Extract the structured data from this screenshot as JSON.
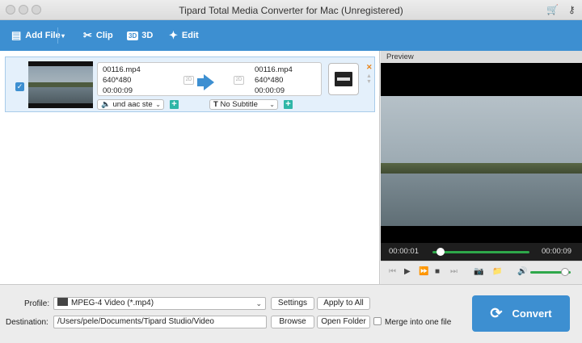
{
  "window": {
    "title": "Tipard Total Media Converter for Mac (Unregistered)"
  },
  "toolbar": {
    "add_file": "Add File",
    "clip": "Clip",
    "three_d": "3D",
    "three_d_badge": "3D",
    "edit": "Edit"
  },
  "file": {
    "source": {
      "name": "00116.mp4",
      "resolution": "640*480",
      "duration": "00:00:09"
    },
    "output": {
      "name": "00116.mp4",
      "resolution": "640*480",
      "duration": "00:00:09"
    },
    "tag_2d": "2D",
    "audio_track": "und aac ste",
    "subtitle": "No Subtitle",
    "checked": true
  },
  "preview": {
    "label": "Preview",
    "current_time": "00:00:01",
    "total_time": "00:00:09",
    "progress": 0.08,
    "volume": 0.85
  },
  "bottom": {
    "profile_label": "Profile:",
    "profile_value": "MPEG-4 Video (*.mp4)",
    "settings": "Settings",
    "apply_to_all": "Apply to All",
    "destination_label": "Destination:",
    "destination_value": "/Users/pele/Documents/Tipard Studio/Video",
    "browse": "Browse",
    "open_folder": "Open Folder",
    "merge_label": "Merge into one file",
    "convert": "Convert"
  },
  "colors": {
    "accent": "#3d8fd1",
    "progress": "#2ea84a",
    "add": "#2eb6a7",
    "close": "#e8841a"
  }
}
